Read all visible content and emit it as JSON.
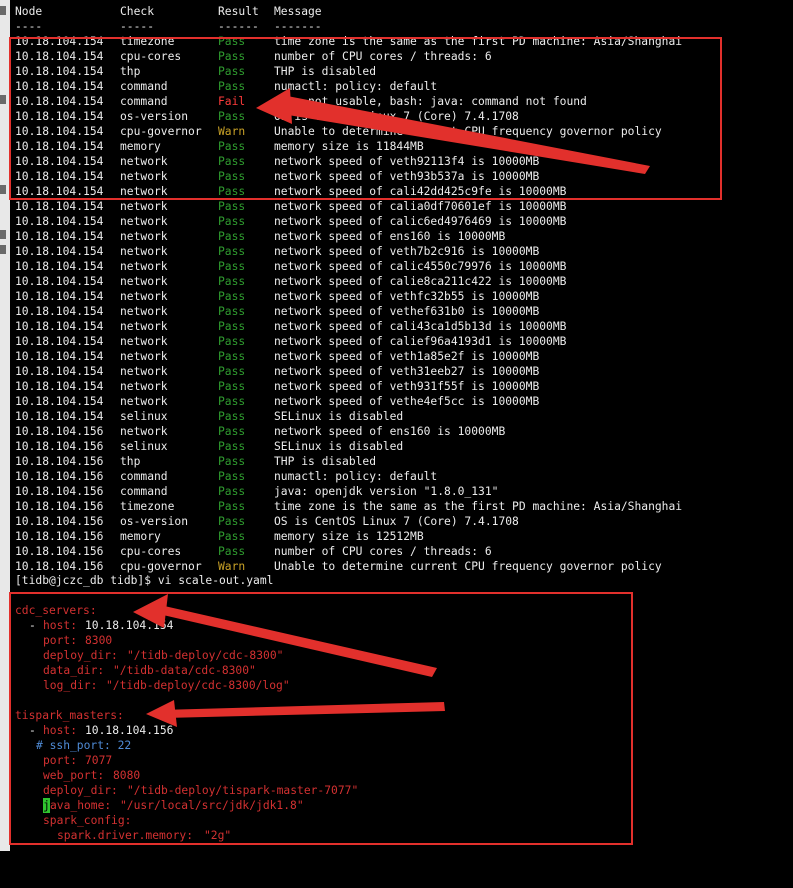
{
  "header": {
    "node": "Node",
    "check": "Check",
    "result": "Result",
    "message": "Message"
  },
  "separator": {
    "node": "----",
    "check": "-----",
    "result": "------",
    "message": "-------"
  },
  "rows": [
    {
      "node": "10.18.104.154",
      "check": "timezone",
      "result": "Pass",
      "message": "time zone is the same as the first PD machine: Asia/Shanghai"
    },
    {
      "node": "10.18.104.154",
      "check": "cpu-cores",
      "result": "Pass",
      "message": "number of CPU cores / threads: 6"
    },
    {
      "node": "10.18.104.154",
      "check": "thp",
      "result": "Pass",
      "message": "THP is disabled"
    },
    {
      "node": "10.18.104.154",
      "check": "command",
      "result": "Pass",
      "message": "numactl: policy: default"
    },
    {
      "node": "10.18.104.154",
      "check": "command",
      "result": "Fail",
      "message": "java not usable, bash: java: command not found"
    },
    {
      "node": "10.18.104.154",
      "check": "os-version",
      "result": "Pass",
      "message": "OS is CentOS Linux 7 (Core) 7.4.1708"
    },
    {
      "node": "10.18.104.154",
      "check": "cpu-governor",
      "result": "Warn",
      "message": "Unable to determine current CPU frequency governor policy"
    },
    {
      "node": "10.18.104.154",
      "check": "memory",
      "result": "Pass",
      "message": "memory size is 11844MB"
    },
    {
      "node": "10.18.104.154",
      "check": "network",
      "result": "Pass",
      "message": "network speed of veth92113f4 is 10000MB"
    },
    {
      "node": "10.18.104.154",
      "check": "network",
      "result": "Pass",
      "message": "network speed of veth93b537a is 10000MB"
    },
    {
      "node": "10.18.104.154",
      "check": "network",
      "result": "Pass",
      "message": "network speed of cali42dd425c9fe is 10000MB"
    },
    {
      "node": "10.18.104.154",
      "check": "network",
      "result": "Pass",
      "message": "network speed of calia0df70601ef is 10000MB"
    },
    {
      "node": "10.18.104.154",
      "check": "network",
      "result": "Pass",
      "message": "network speed of calic6ed4976469 is 10000MB"
    },
    {
      "node": "10.18.104.154",
      "check": "network",
      "result": "Pass",
      "message": "network speed of ens160 is 10000MB"
    },
    {
      "node": "10.18.104.154",
      "check": "network",
      "result": "Pass",
      "message": "network speed of veth7b2c916 is 10000MB"
    },
    {
      "node": "10.18.104.154",
      "check": "network",
      "result": "Pass",
      "message": "network speed of calic4550c79976 is 10000MB"
    },
    {
      "node": "10.18.104.154",
      "check": "network",
      "result": "Pass",
      "message": "network speed of calie8ca211c422 is 10000MB"
    },
    {
      "node": "10.18.104.154",
      "check": "network",
      "result": "Pass",
      "message": "network speed of vethfc32b55 is 10000MB"
    },
    {
      "node": "10.18.104.154",
      "check": "network",
      "result": "Pass",
      "message": "network speed of vethef631b0 is 10000MB"
    },
    {
      "node": "10.18.104.154",
      "check": "network",
      "result": "Pass",
      "message": "network speed of cali43ca1d5b13d is 10000MB"
    },
    {
      "node": "10.18.104.154",
      "check": "network",
      "result": "Pass",
      "message": "network speed of calief96a4193d1 is 10000MB"
    },
    {
      "node": "10.18.104.154",
      "check": "network",
      "result": "Pass",
      "message": "network speed of veth1a85e2f is 10000MB"
    },
    {
      "node": "10.18.104.154",
      "check": "network",
      "result": "Pass",
      "message": "network speed of veth31eeb27 is 10000MB"
    },
    {
      "node": "10.18.104.154",
      "check": "network",
      "result": "Pass",
      "message": "network speed of veth931f55f is 10000MB"
    },
    {
      "node": "10.18.104.154",
      "check": "network",
      "result": "Pass",
      "message": "network speed of vethe4ef5cc is 10000MB"
    },
    {
      "node": "10.18.104.154",
      "check": "selinux",
      "result": "Pass",
      "message": "SELinux is disabled"
    },
    {
      "node": "10.18.104.156",
      "check": "network",
      "result": "Pass",
      "message": "network speed of ens160 is 10000MB"
    },
    {
      "node": "10.18.104.156",
      "check": "selinux",
      "result": "Pass",
      "message": "SELinux is disabled"
    },
    {
      "node": "10.18.104.156",
      "check": "thp",
      "result": "Pass",
      "message": "THP is disabled"
    },
    {
      "node": "10.18.104.156",
      "check": "command",
      "result": "Pass",
      "message": "numactl: policy: default"
    },
    {
      "node": "10.18.104.156",
      "check": "command",
      "result": "Pass",
      "message": "java: openjdk version \"1.8.0_131\""
    },
    {
      "node": "10.18.104.156",
      "check": "timezone",
      "result": "Pass",
      "message": "time zone is the same as the first PD machine: Asia/Shanghai"
    },
    {
      "node": "10.18.104.156",
      "check": "os-version",
      "result": "Pass",
      "message": "OS is CentOS Linux 7 (Core) 7.4.1708"
    },
    {
      "node": "10.18.104.156",
      "check": "memory",
      "result": "Pass",
      "message": "memory size is 12512MB"
    },
    {
      "node": "10.18.104.156",
      "check": "cpu-cores",
      "result": "Pass",
      "message": "number of CPU cores / threads: 6"
    },
    {
      "node": "10.18.104.156",
      "check": "cpu-governor",
      "result": "Warn",
      "message": "Unable to determine current CPU frequency governor policy"
    }
  ],
  "prompt": "[tidb@jczc_db tidb]$ vi scale-out.yaml",
  "yaml": {
    "cdc_servers_key": "cdc_servers:",
    "cdc_host_dash": "- ",
    "cdc_host_key": "host:",
    "cdc_host_val": "10.18.104.154",
    "cdc_port_key": "port:",
    "cdc_port_val": "8300",
    "cdc_deploy_key": "deploy_dir:",
    "cdc_deploy_val": "\"/tidb-deploy/cdc-8300\"",
    "cdc_data_key": "data_dir:",
    "cdc_data_val": "\"/tidb-data/cdc-8300\"",
    "cdc_log_key": "log_dir:",
    "cdc_log_val": "\"/tidb-deploy/cdc-8300/log\"",
    "tispark_key": "tispark_masters:",
    "ts_host_dash": "- ",
    "ts_host_key": "host:",
    "ts_host_val": "10.18.104.156",
    "ts_ssh_comment": "# ssh_port: 22",
    "ts_port_key": "port:",
    "ts_port_val": "7077",
    "ts_webport_key": "web_port:",
    "ts_webport_val": "8080",
    "ts_deploy_key": "deploy_dir:",
    "ts_deploy_val": "\"/tidb-deploy/tispark-master-7077\"",
    "ts_java_cursor": "j",
    "ts_java_key": "ava_home:",
    "ts_java_val": "\"/usr/local/src/jdk/jdk1.8\"",
    "ts_spark_key": "spark_config:",
    "ts_sparkmem_key": "spark.driver.memory:",
    "ts_sparkmem_val": "\"2g\""
  },
  "colors": {
    "pass": "#2f9c2f",
    "fail": "#ff3b3b",
    "warn": "#c9a227",
    "annotation": "#e2302c"
  }
}
